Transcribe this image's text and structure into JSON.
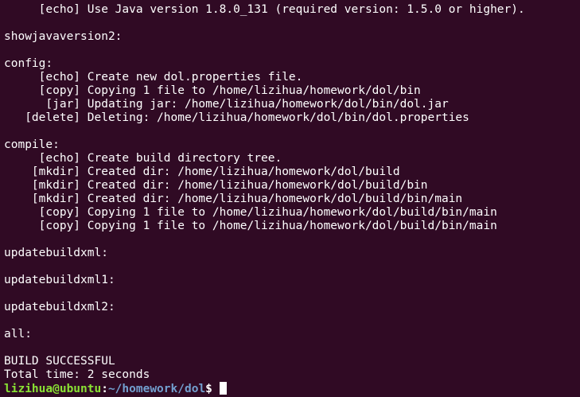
{
  "terminal": {
    "lines": [
      "     [echo] Use Java version 1.8.0_131 (required version: 1.5.0 or higher).",
      "",
      "showjavaversion2:",
      "",
      "config:",
      "     [echo] Create new dol.properties file.",
      "     [copy] Copying 1 file to /home/lizihua/homework/dol/bin",
      "      [jar] Updating jar: /home/lizihua/homework/dol/bin/dol.jar",
      "   [delete] Deleting: /home/lizihua/homework/dol/bin/dol.properties",
      "",
      "compile:",
      "     [echo] Create build directory tree.",
      "    [mkdir] Created dir: /home/lizihua/homework/dol/build",
      "    [mkdir] Created dir: /home/lizihua/homework/dol/build/bin",
      "    [mkdir] Created dir: /home/lizihua/homework/dol/build/bin/main",
      "     [copy] Copying 1 file to /home/lizihua/homework/dol/build/bin/main",
      "     [copy] Copying 1 file to /home/lizihua/homework/dol/build/bin/main",
      "",
      "updatebuildxml:",
      "",
      "updatebuildxml1:",
      "",
      "updatebuildxml2:",
      "",
      "all:",
      "",
      "BUILD SUCCESSFUL",
      "Total time: 2 seconds"
    ],
    "prompt": {
      "user_host": "lizihua@ubuntu",
      "separator": ":",
      "path": "~/homework/dol",
      "symbol": "$ "
    },
    "colors": {
      "background": "#300a24",
      "foreground": "#ffffff",
      "prompt_user": "#8ae234",
      "prompt_path": "#729fcf"
    }
  }
}
